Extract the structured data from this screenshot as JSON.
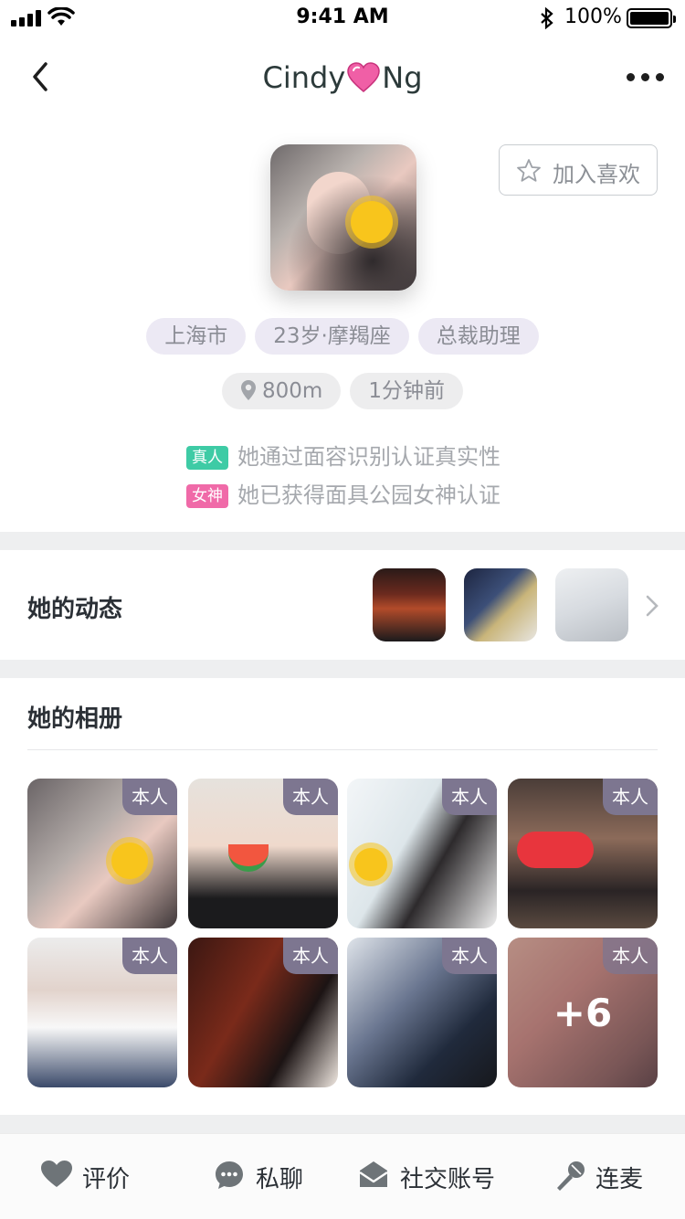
{
  "status_bar": {
    "time": "9:41 AM",
    "battery": "100%"
  },
  "nav": {
    "name_first": "Cindy",
    "name_last": "Ng",
    "more": "more"
  },
  "profile": {
    "favorite_label": "加入喜欢",
    "tags": [
      "上海市",
      "23岁·摩羯座",
      "总裁助理"
    ],
    "distance": "800m",
    "last_active": "1分钟前",
    "verifications": [
      {
        "badge": "真人",
        "text": "她通过面容识别认证真实性",
        "color": "#3ecba5"
      },
      {
        "badge": "女神",
        "text": "她已获得面具公园女神认证",
        "color": "#f06aa8"
      }
    ]
  },
  "moments": {
    "title": "她的动态"
  },
  "album": {
    "title": "她的相册",
    "self_label": "本人",
    "more_count": "+6"
  },
  "bottom_bar": {
    "items": [
      {
        "label": "评价",
        "icon": "heart-icon"
      },
      {
        "label": "私聊",
        "icon": "chat-bubble-icon"
      },
      {
        "label": "社交账号",
        "icon": "envelope-icon"
      },
      {
        "label": "连麦",
        "icon": "microphone-icon"
      }
    ]
  },
  "colors": {
    "accent_tag": "#ece9f4",
    "self_badge": "#7d7690"
  }
}
